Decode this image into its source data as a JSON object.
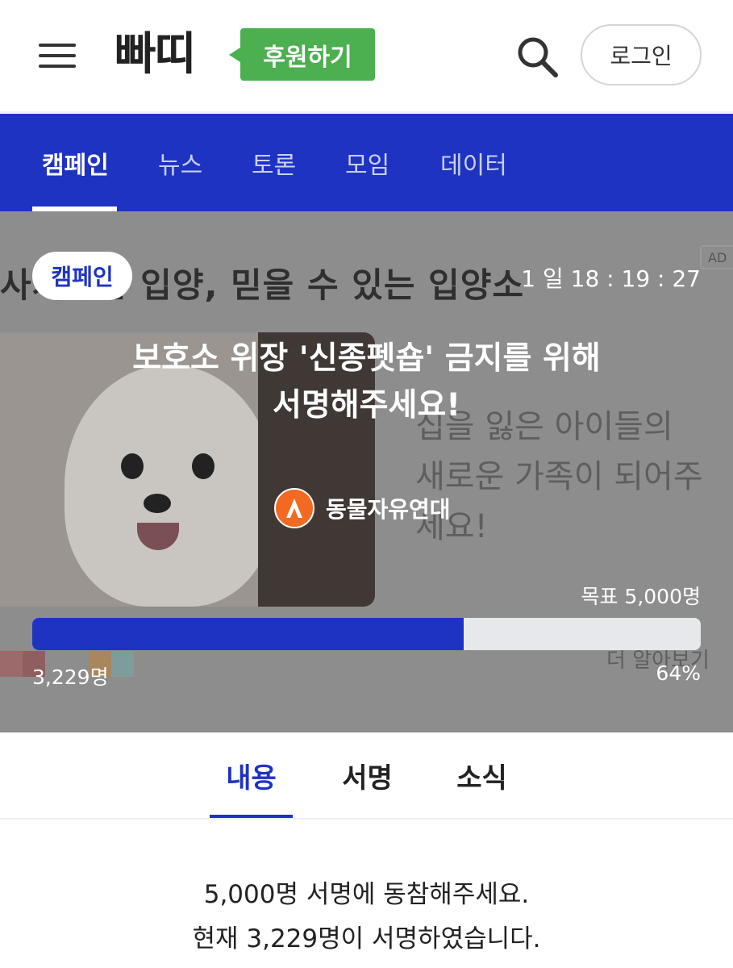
{
  "header": {
    "logo": "빠띠",
    "donate_label": "후원하기",
    "login_label": "로그인"
  },
  "nav": {
    "items": [
      {
        "label": "캠페인",
        "active": true
      },
      {
        "label": "뉴스"
      },
      {
        "label": "토론"
      },
      {
        "label": "모임"
      },
      {
        "label": "데이터"
      }
    ]
  },
  "hero": {
    "badge": "캠페인",
    "countdown": "1 일 18 : 19 : 27",
    "title_line1": "보호소 위장 '신종펫숍' 금지를 위해",
    "title_line2": "서명해주세요!",
    "org_name": "동물자유연대",
    "goal": "목표 5,000명",
    "count": "3,229명",
    "percent": "64%",
    "progress_fraction": 0.6458,
    "background": {
      "title": "사지않는 입양, 믿을 수 있는 입양소",
      "ad": "AD",
      "text_lines": [
        "집을 잃은 아이들의",
        "새로운 가족이 되어주",
        "세요!"
      ],
      "more": "더 알아보기"
    }
  },
  "content_tabs": [
    {
      "label": "내용",
      "active": true
    },
    {
      "label": "서명"
    },
    {
      "label": "소식"
    }
  ],
  "summary": {
    "line1": "5,000명 서명에 동참해주세요.",
    "line2": "현재 3,229명이 서명하였습니다."
  },
  "colors": {
    "brand_blue": "#1f33c2",
    "donate_green": "#4caf50",
    "org_orange": "#f26a21"
  }
}
